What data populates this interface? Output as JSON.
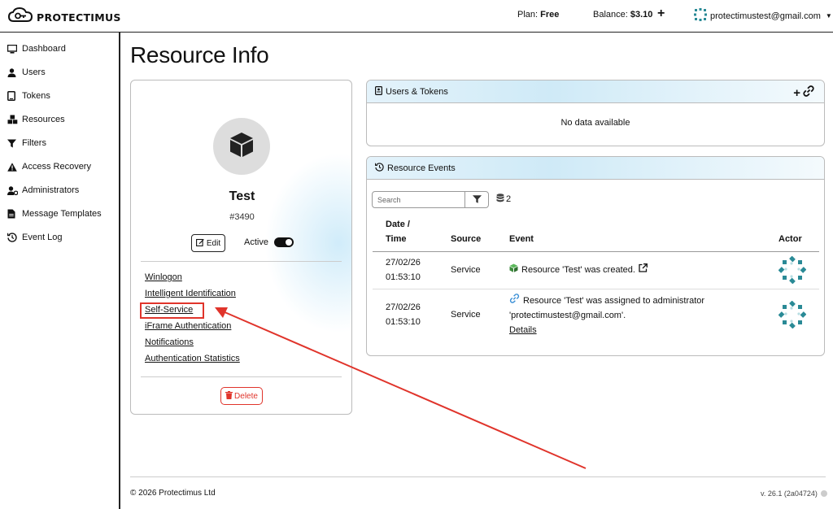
{
  "app": {
    "brand": "PROTECTIMUS",
    "plan_label": "Plan:",
    "plan_value": "Free",
    "balance_label": "Balance:",
    "balance_value": "$3.10",
    "add_icon": "+",
    "user_email": "protectimustest@gmail.com"
  },
  "sidebar": {
    "items": [
      {
        "label": "Dashboard",
        "icon": "monitor-icon"
      },
      {
        "label": "Users",
        "icon": "user-icon"
      },
      {
        "label": "Tokens",
        "icon": "tablet-icon"
      },
      {
        "label": "Resources",
        "icon": "cubes-icon"
      },
      {
        "label": "Filters",
        "icon": "filter-icon"
      },
      {
        "label": "Access Recovery",
        "icon": "warning-icon"
      },
      {
        "label": "Administrators",
        "icon": "user-gear-icon"
      },
      {
        "label": "Message Templates",
        "icon": "file-icon"
      },
      {
        "label": "Event Log",
        "icon": "history-icon"
      }
    ]
  },
  "page": {
    "title": "Resource Info"
  },
  "resource": {
    "name": "Test",
    "id": "#3490",
    "edit_label": "Edit",
    "active_label": "Active",
    "active": true,
    "links": [
      "Winlogon",
      "Intelligent Identification",
      "Self-Service",
      "iFrame Authentication",
      "Notifications",
      "Authentication Statistics"
    ],
    "highlighted_link": "Self-Service",
    "delete_label": "Delete"
  },
  "users_tokens": {
    "title": "Users & Tokens",
    "empty_text": "No data available"
  },
  "events": {
    "title": "Resource Events",
    "search_placeholder": "Search",
    "count": "2",
    "columns": {
      "date": "Date /",
      "time": "Time",
      "source": "Source",
      "event": "Event",
      "actor": "Actor"
    },
    "rows": [
      {
        "date": "27/02/26",
        "time": "01:53:10",
        "source": "Service",
        "event_line1": "Resource 'Test' was created.",
        "event_line2": "",
        "event_link": ""
      },
      {
        "date": "27/02/26",
        "time": "01:53:10",
        "source": "Service",
        "event_line1": "Resource 'Test' was assigned to administrator",
        "event_line2": "'protectimustest@gmail.com'.",
        "event_link": "Details"
      }
    ]
  },
  "footer": {
    "copyright": "© 2026 Protectimus Ltd",
    "version": "v. 26.1 (2a04724)"
  },
  "colors": {
    "highlight": "#e0342b",
    "actor_icon": "#2a8a96",
    "header_gradient": "#cfeaf7"
  }
}
